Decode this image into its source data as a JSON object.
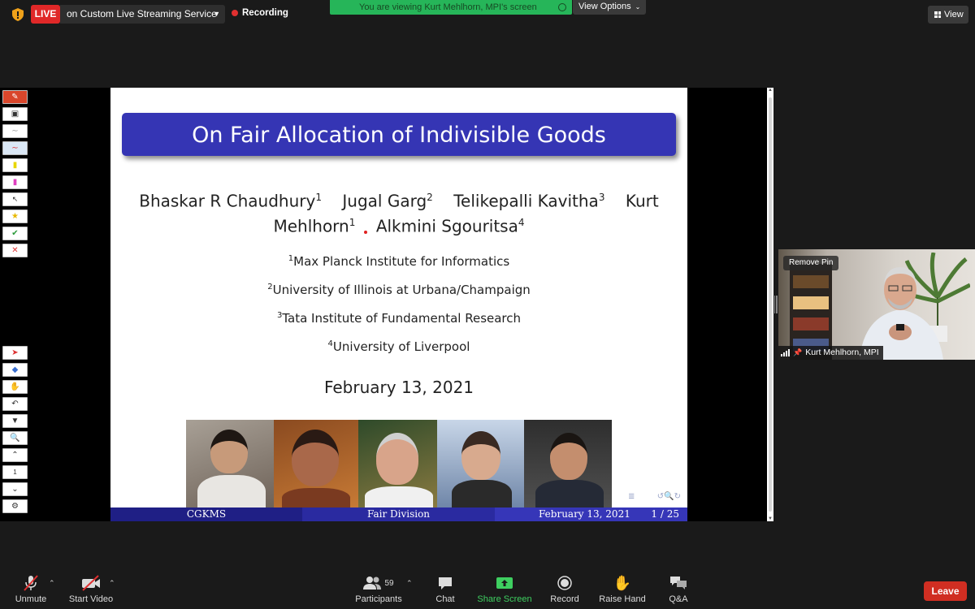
{
  "topbar": {
    "live_label": "LIVE",
    "stream_target": "on Custom Live Streaming Service",
    "recording_label": "Recording",
    "viewing_banner": "You are viewing Kurt Mehlhorn, MPI's screen",
    "view_options_label": "View Options",
    "view_label": "View"
  },
  "slide": {
    "title": "On Fair Allocation of Indivisible Goods",
    "authors": [
      {
        "name": "Bhaskar R Chaudhury",
        "sup": "1"
      },
      {
        "name": "Jugal Garg",
        "sup": "2"
      },
      {
        "name": "Telikepalli Kavitha",
        "sup": "3"
      },
      {
        "name": "Kurt Mehlhorn",
        "sup": "1"
      },
      {
        "name": "Alkmini Sgouritsa",
        "sup": "4"
      }
    ],
    "author_parts": {
      "a1": "Bhaskar R Chaudhury",
      "a2": "Jugal Garg",
      "a3": "Telikepalli Kavitha",
      "a4_first": "Kurt",
      "a4_last": "Mehlhorn",
      "a5": "Alkmini Sgouritsa",
      "s1": "1",
      "s2": "2",
      "s3": "3",
      "s4": "1",
      "s5": "4"
    },
    "affiliations": [
      {
        "sup": "1",
        "text": "Max Planck Institute for Informatics"
      },
      {
        "sup": "2",
        "text": "University of Illinois at Urbana/Champaign"
      },
      {
        "sup": "3",
        "text": "Tata Institute of Fundamental Research"
      },
      {
        "sup": "4",
        "text": "University of Liverpool"
      }
    ],
    "date": "February 13, 2021",
    "footer": {
      "left": "CGKMS",
      "center": "Fair Division",
      "date": "February 13, 2021",
      "page": "1 / 25"
    }
  },
  "annotation_tools": {
    "top": [
      "pen-tool",
      "save-tool",
      "pen-thin-tool",
      "pen-highlight-tool",
      "yellow-highlighter-tool",
      "pink-highlighter-tool",
      "pointer-tool",
      "star-tool",
      "check-tool",
      "cross-tool"
    ],
    "bottom": [
      "select-tool",
      "eraser-tool",
      "hand-tool",
      "undo-tool",
      "dropdown-tool",
      "zoom-tool",
      "page-up-tool",
      "page-number-tool",
      "page-down-tool",
      "settings-tool"
    ],
    "page_number": "1"
  },
  "video": {
    "remove_pin_label": "Remove Pin",
    "participant_name": "Kurt Mehlhorn, MPI"
  },
  "bottombar": {
    "unmute": "Unmute",
    "start_video": "Start Video",
    "participants": "Participants",
    "participants_count": "59",
    "chat": "Chat",
    "share_screen": "Share Screen",
    "record": "Record",
    "raise_hand": "Raise Hand",
    "qa": "Q&A",
    "leave": "Leave"
  },
  "colors": {
    "live": "#e02828",
    "banner": "#26b559",
    "slide_title_bg": "#3535b4",
    "leave": "#d02e22",
    "share_screen": "#3ecf60"
  }
}
